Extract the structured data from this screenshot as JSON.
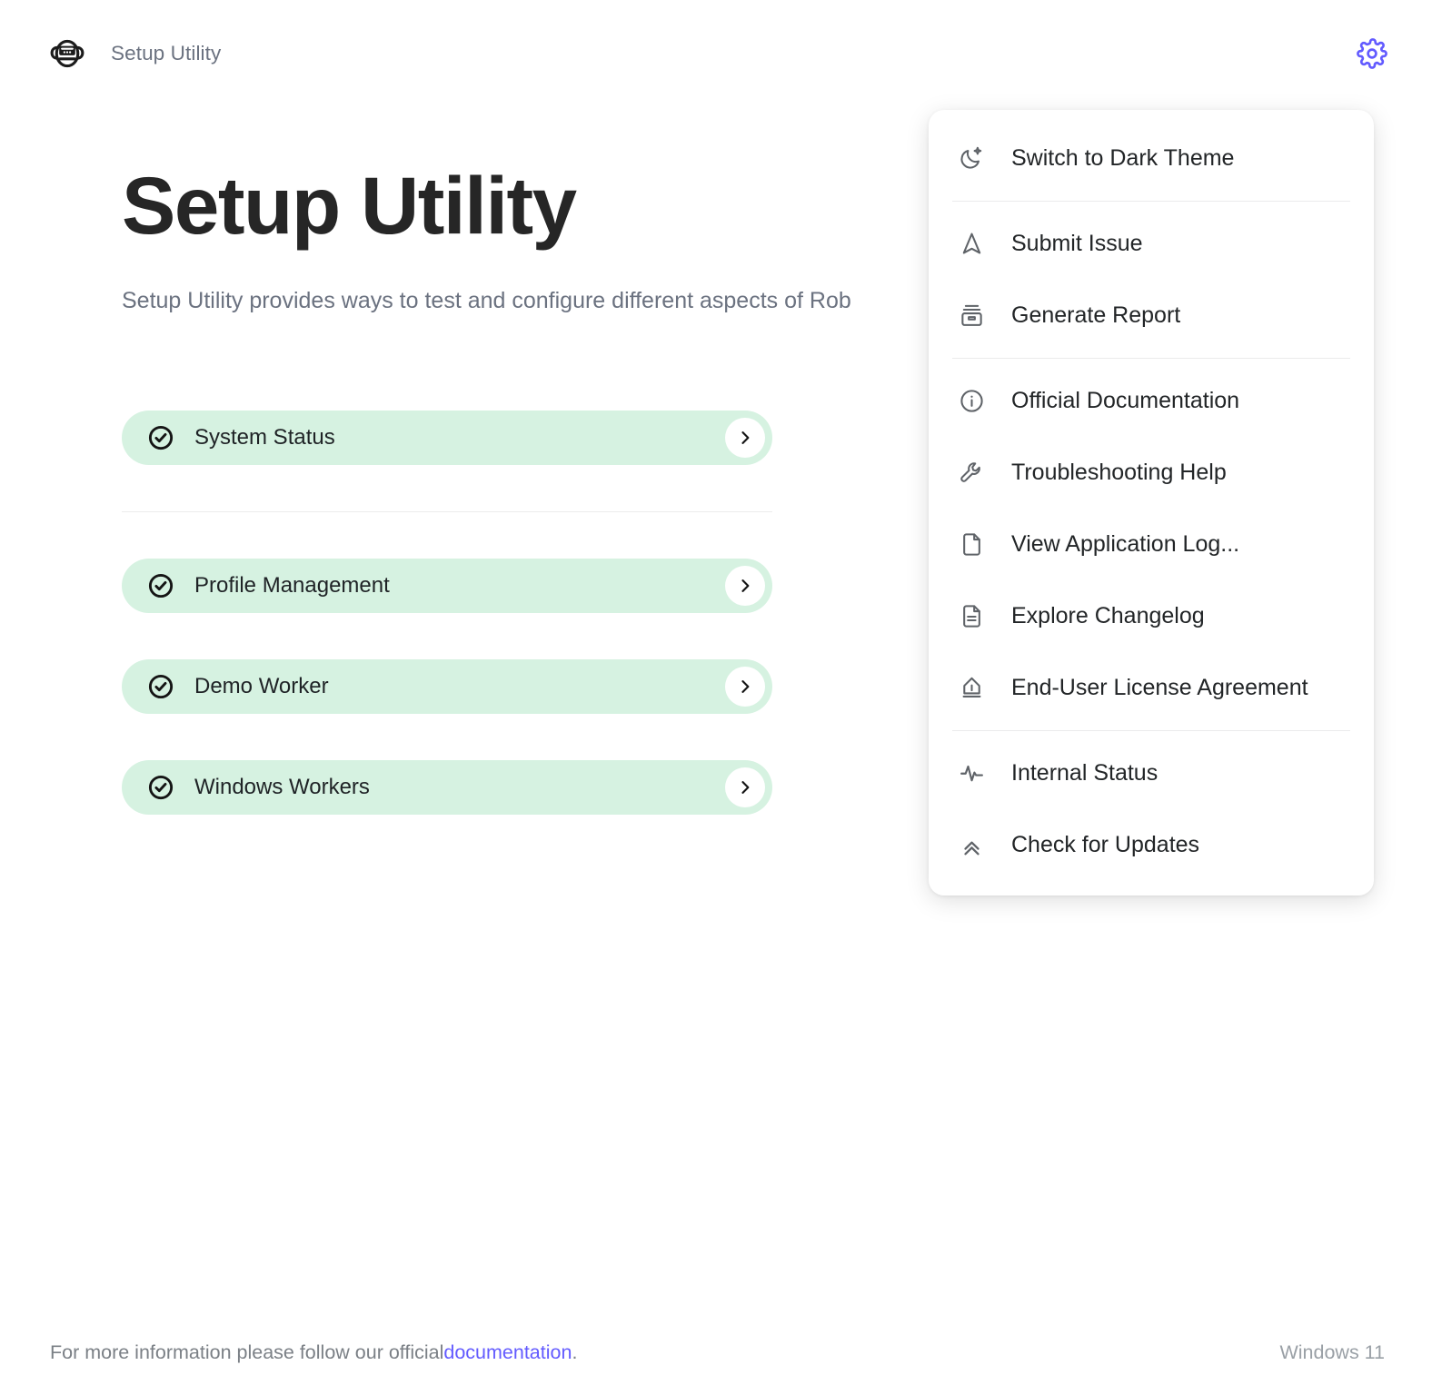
{
  "window": {
    "app_title": "Setup Utility",
    "logo_icon": "robot-face-icon",
    "gear_icon": "gear-icon",
    "gear_color": "#635bff"
  },
  "hero": {
    "title": "Setup Utility",
    "subtitle": "Setup Utility provides ways to test and configure different aspects of Rob"
  },
  "actions": {
    "accent_color": "#d6f2e1",
    "items": [
      {
        "label": "System Status",
        "status_icon": "check-circle-icon",
        "chevron_icon": "chevron-right-icon"
      },
      {
        "label": "Profile Management",
        "status_icon": "check-circle-icon",
        "chevron_icon": "chevron-right-icon"
      },
      {
        "label": "Demo Worker",
        "status_icon": "check-circle-icon",
        "chevron_icon": "chevron-right-icon"
      },
      {
        "label": "Windows Workers",
        "status_icon": "check-circle-icon",
        "chevron_icon": "chevron-right-icon"
      }
    ]
  },
  "menu": {
    "items": [
      {
        "label": "Switch to Dark Theme",
        "icon": "moon-sparkle-icon"
      },
      {
        "label": "Submit Issue",
        "icon": "navigation-arrow-icon"
      },
      {
        "label": "Generate Report",
        "icon": "archive-inbox-icon"
      },
      {
        "label": "Official Documentation",
        "icon": "info-circle-icon"
      },
      {
        "label": "Troubleshooting Help",
        "icon": "wrench-icon"
      },
      {
        "label": "View Application Log...",
        "icon": "file-blank-icon"
      },
      {
        "label": "Explore Changelog",
        "icon": "file-text-icon"
      },
      {
        "label": "End-User License Agreement",
        "icon": "pen-nib-icon"
      },
      {
        "label": "Internal Status",
        "icon": "activity-pulse-icon"
      },
      {
        "label": "Check for Updates",
        "icon": "chevrons-up-icon"
      }
    ]
  },
  "footer": {
    "text_before": "For more information please follow our official ",
    "link_text": "documentation",
    "text_after": ".",
    "os_label": "Windows 11",
    "link_color": "#635bff"
  }
}
